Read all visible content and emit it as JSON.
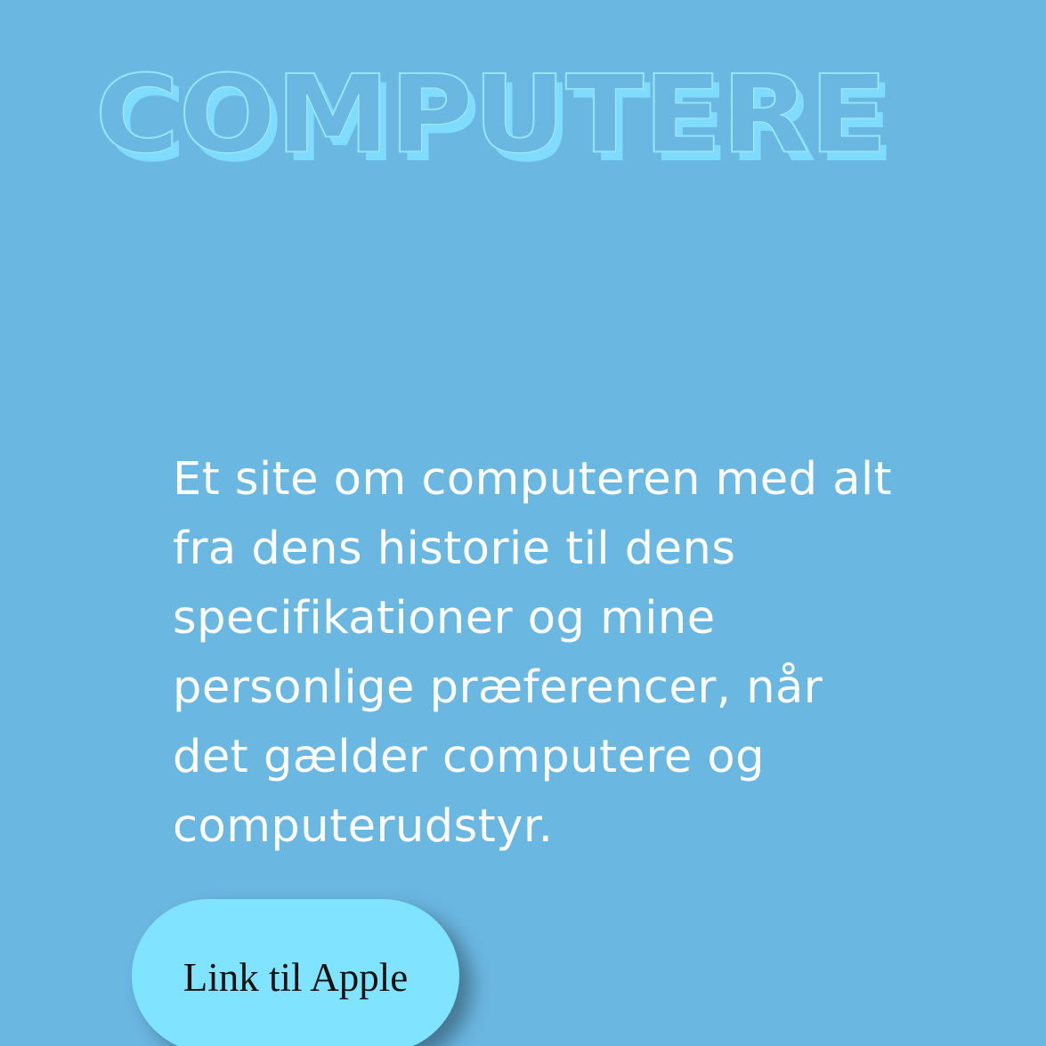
{
  "header": {
    "title": "COMPUTERE"
  },
  "main": {
    "description": "Et site om computeren med alt fra dens historie til dens specifikationer og mine personlige præferencer, når det gælder computere og computerudstyr.",
    "link_label": "Link til Apple"
  },
  "colors": {
    "background": "#6ab7e2",
    "title_accent": "#7fdcff",
    "button_background": "#80e3ff",
    "description_text": "#ffffff",
    "button_text": "#111111"
  }
}
